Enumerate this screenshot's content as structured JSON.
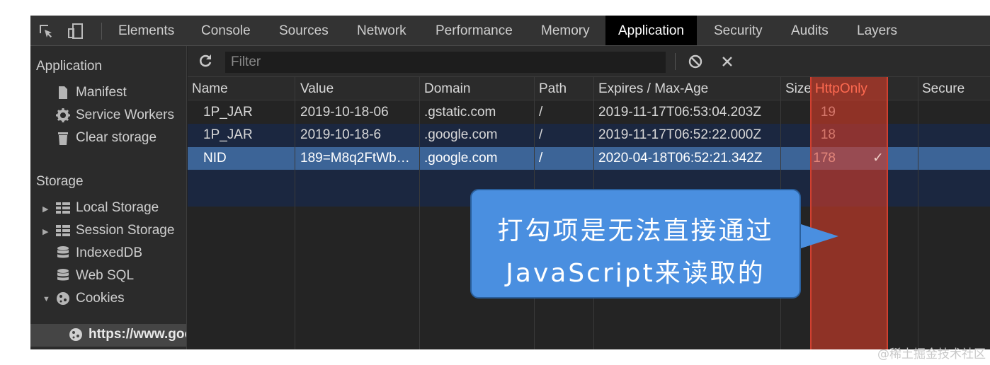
{
  "tabs": [
    "Elements",
    "Console",
    "Sources",
    "Network",
    "Performance",
    "Memory",
    "Application",
    "Security",
    "Audits",
    "Layers"
  ],
  "active_tab": "Application",
  "sidebar": {
    "application_heading": "Application",
    "application_items": [
      "Manifest",
      "Service Workers",
      "Clear storage"
    ],
    "storage_heading": "Storage",
    "storage_items": [
      "Local Storage",
      "Session Storage",
      "IndexedDB",
      "Web SQL",
      "Cookies"
    ],
    "cookie_origin": "https://www.goo"
  },
  "toolbar": {
    "filter_placeholder": "Filter"
  },
  "table": {
    "columns": [
      "Name",
      "Value",
      "Domain",
      "Path",
      "Expires / Max-Age",
      "Size",
      "HttpOnly",
      "Secure"
    ],
    "rows": [
      {
        "name": "1P_JAR",
        "value": "2019-10-18-06",
        "domain": ".gstatic.com",
        "path": "/",
        "expires": "2019-11-17T06:53:04.203Z",
        "size": "19",
        "httponly": ""
      },
      {
        "name": "1P_JAR",
        "value": "2019-10-18-6",
        "domain": ".google.com",
        "path": "/",
        "expires": "2019-11-17T06:52:22.000Z",
        "size": "18",
        "httponly": ""
      },
      {
        "name": "NID",
        "value": "189=M8q2FtWb…",
        "domain": ".google.com",
        "path": "/",
        "expires": "2020-04-18T06:52:21.342Z",
        "size": "178",
        "httponly": "✓"
      }
    ]
  },
  "callout": {
    "line1": "打勾项是无法直接通过",
    "line2": "JavaScript来读取的"
  },
  "watermark": "@稀土掘金技术社区",
  "colors": {
    "selected_row": "#3c6497",
    "httponly_highlight": "#c8402e",
    "callout": "#4a8fe0"
  }
}
